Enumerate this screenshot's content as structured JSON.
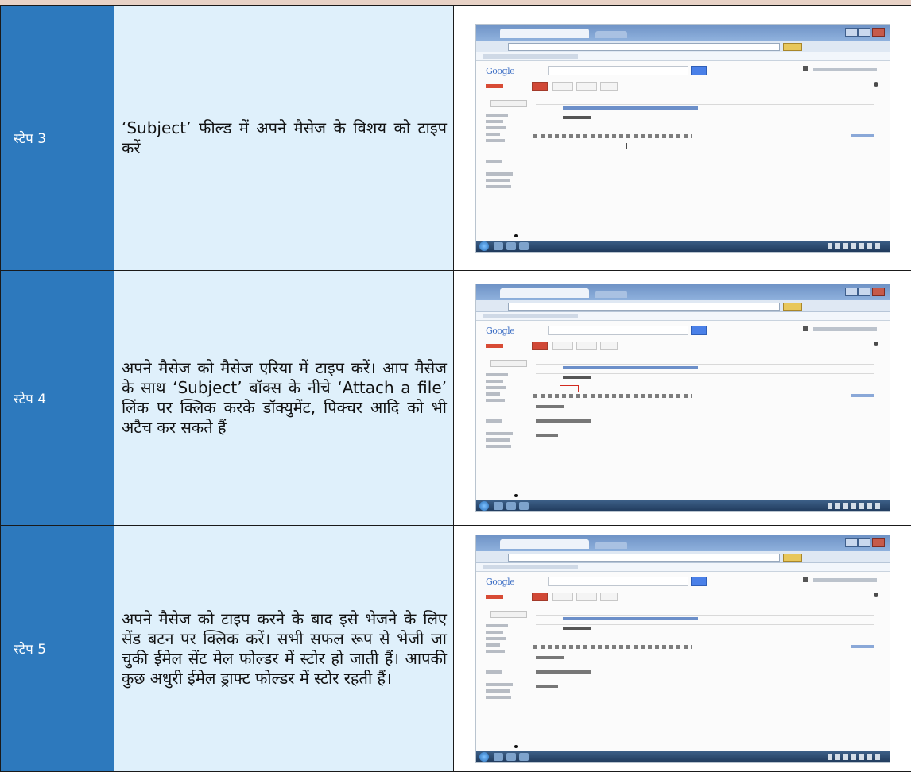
{
  "rows": [
    {
      "step": "स्टेप 3",
      "description": "‘Subject’ फील्ड में अपने मैसेज के विशय को टाइप करें"
    },
    {
      "step": "स्टेप 4",
      "description": "अपने मैसेज को मैसेज एरिया में टाइप करें। आप मैसेज के साथ ‘Subject’ बॉक्स के नीचे ‘Attach a file’ लिंक पर क्लिक करके डॉक्युमेंट, पिक्चर आदि को भी अटैच कर सकते हैं"
    },
    {
      "step": "स्टेप 5",
      "description": "अपने मैसेज को टाइप करने के बाद इसे भेजने के लिए सेंड बटन पर क्लिक करें। सभी सफल रूप से भेजी जा चुकी ईमेल सेंट मेल फोल्डर में स्टोर हो जाती हैं। आपकी कुछ अधुरी ईमेल ड्राफ्ट फोल्डर में स्टोर रहती हैं।"
    }
  ],
  "screenshot": {
    "logo_text": "Google"
  },
  "colors": {
    "step_cell": "#2d79bd",
    "description_cell": "#dff0fb",
    "border": "#1a1a1a"
  }
}
